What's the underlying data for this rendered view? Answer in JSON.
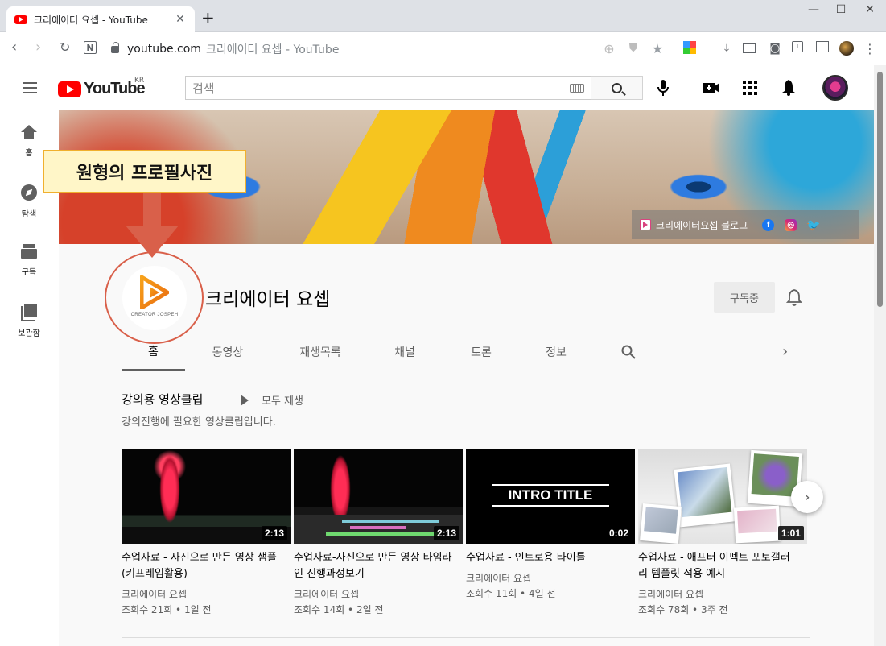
{
  "browser": {
    "tab_title": "크리에이터 요셉 - YouTube",
    "tab_close": "✕",
    "new_tab": "+",
    "address_host": "youtube.com",
    "address_path": "크리에이터 요셉 - YouTube"
  },
  "masthead": {
    "logo_text": "YouTube",
    "country_code": "KR",
    "search_placeholder": "검색"
  },
  "guide": {
    "items": [
      {
        "label": "홈",
        "icon": "home-icon"
      },
      {
        "label": "탐색",
        "icon": "explore-icon"
      },
      {
        "label": "구독",
        "icon": "subscriptions-icon"
      },
      {
        "label": "보관함",
        "icon": "library-icon"
      }
    ]
  },
  "banner": {
    "link_text": "크리에이터요셉 블로그",
    "social": [
      "facebook",
      "instagram",
      "twitter"
    ]
  },
  "channel": {
    "name": "크리에이터 요셉",
    "avatar_text": "CREATOR JOSPEH",
    "subscribe_label": "구독중",
    "tabs": [
      "홈",
      "동영상",
      "재생목록",
      "채널",
      "토론",
      "정보"
    ],
    "active_tab": "홈"
  },
  "shelf": {
    "title": "강의용 영상클립",
    "play_all": "모두 재생",
    "description": "강의진행에 필요한 영상클립입니다.",
    "videos": [
      {
        "title": "수업자료 - 사진으로 만든 영상 샘플 (키프레임활용)",
        "channel": "크리에이터 요셉",
        "meta": "조회수 21회 • 1일 전",
        "duration": "2:13"
      },
      {
        "title": "수업자료-사진으로 만든 영상 타임라인 진행과정보기",
        "channel": "크리에이터 요셉",
        "meta": "조회수 14회 • 2일 전",
        "duration": "2:13"
      },
      {
        "title": "수업자료 - 인트로용 타이틀",
        "channel": "크리에이터 요셉",
        "meta": "조회수 11회 • 4일 전",
        "duration": "0:02",
        "thumb_text": "INTRO TITLE"
      },
      {
        "title": "수업자료 - 애프터 이펙트 포토갤러리 템플릿 적용 예시",
        "channel": "크리에이터 요셉",
        "meta": "조회수 78회 • 3주 전",
        "duration": "1:01"
      }
    ]
  },
  "annotation": {
    "callout_text": "원형의 프로필사진",
    "color": "#d9604a"
  },
  "colors": {
    "youtube_red": "#ff0000",
    "page_bg": "#f9f9f9"
  }
}
